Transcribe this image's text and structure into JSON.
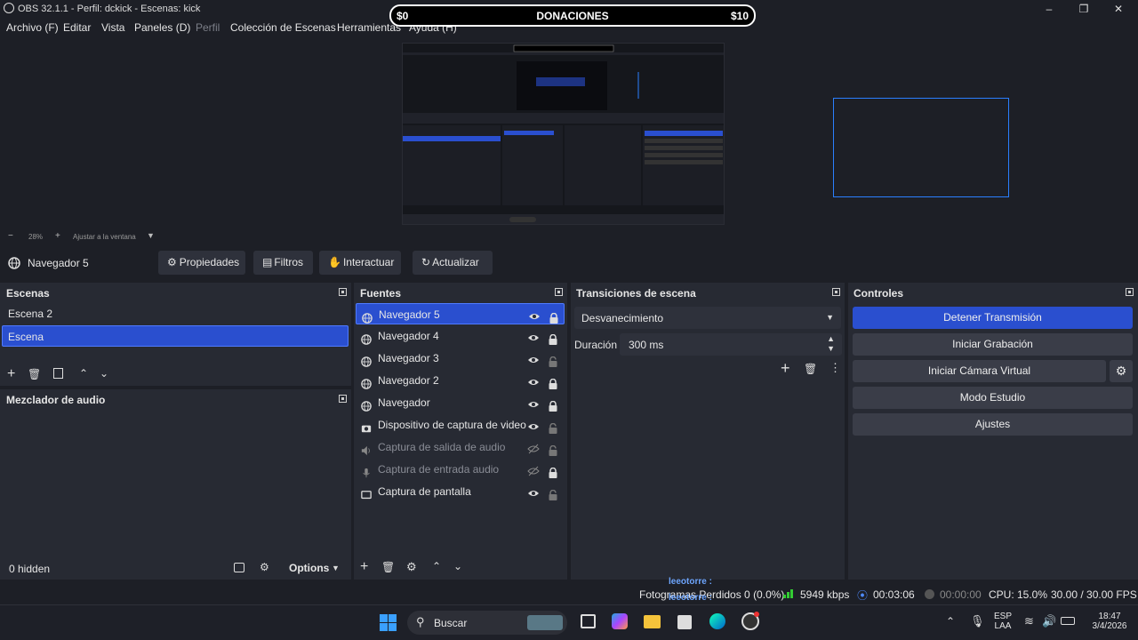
{
  "window": {
    "title": "OBS 32.1.1 - Perfil: dckick - Escenas: kick"
  },
  "menu": [
    "Archivo (F)",
    "Editar",
    "Vista",
    "Paneles (D)",
    "Perfil",
    "Colección de Escenas",
    "Herramientas",
    "Ayuda (H)"
  ],
  "donation": {
    "left": "$0",
    "title": "DONACIONES",
    "right": "$10"
  },
  "zoom": {
    "minus": "−",
    "level": "28%",
    "plus": "+",
    "fit": "Ajustar a la ventana"
  },
  "source_toolbar": {
    "selected_source": "Navegador 5",
    "buttons": [
      "Propiedades",
      "Filtros",
      "Interactuar",
      "Actualizar"
    ]
  },
  "scenes": {
    "title": "Escenas",
    "items": [
      "Escena 2",
      "Escena"
    ],
    "selected": "Escena"
  },
  "mixer": {
    "title": "Mezclador de audio",
    "hidden": "0 hidden",
    "options": "Options"
  },
  "sources": {
    "title": "Fuentes",
    "items": [
      {
        "label": "Navegador 5",
        "icon": "globe-icon",
        "visible": true,
        "locked": true,
        "selected": true
      },
      {
        "label": "Navegador 4",
        "icon": "globe-icon",
        "visible": true,
        "locked": true
      },
      {
        "label": "Navegador 3",
        "icon": "globe-icon",
        "visible": true,
        "locked": false
      },
      {
        "label": "Navegador 2",
        "icon": "globe-icon",
        "visible": true,
        "locked": true
      },
      {
        "label": "Navegador",
        "icon": "globe-icon",
        "visible": true,
        "locked": true
      },
      {
        "label": "Dispositivo de captura de video",
        "icon": "camera-icon",
        "visible": true,
        "locked": false
      },
      {
        "label": "Captura de salida de audio",
        "icon": "speaker-icon",
        "visible": false,
        "locked": false
      },
      {
        "label": "Captura de entrada audio",
        "icon": "microphone-icon",
        "visible": false,
        "locked": true
      },
      {
        "label": "Captura de pantalla",
        "icon": "monitor-icon",
        "visible": true,
        "locked": false
      }
    ]
  },
  "transitions": {
    "title": "Transiciones de escena",
    "type": "Desvanecimiento",
    "duration_label": "Duración",
    "duration_value": "300 ms"
  },
  "controls": {
    "title": "Controles",
    "buttons": [
      "Detener Transmisión",
      "Iniciar Grabación",
      "Iniciar Cámara Virtual",
      "Modo Estudio",
      "Ajustes"
    ]
  },
  "status": {
    "dropped": "Fotogramas Perdidos 0 (0.0%)",
    "bitrate": "5949 kbps",
    "stream_time": "00:03:06",
    "rec_time": "00:00:00",
    "cpu": "CPU: 15.0%",
    "fps": "30.00 / 30.00 FPS"
  },
  "taskbar": {
    "search": "Buscar",
    "lang_top": "ESP",
    "lang_bottom": "LAA",
    "time": "18:47",
    "date": "3/4/2026",
    "chat_user": "leeotorre :"
  },
  "colors": {
    "accent": "#2a4fcf",
    "background": "#1d1f26",
    "dock": "#272a33",
    "selection": "#2a7fff"
  }
}
